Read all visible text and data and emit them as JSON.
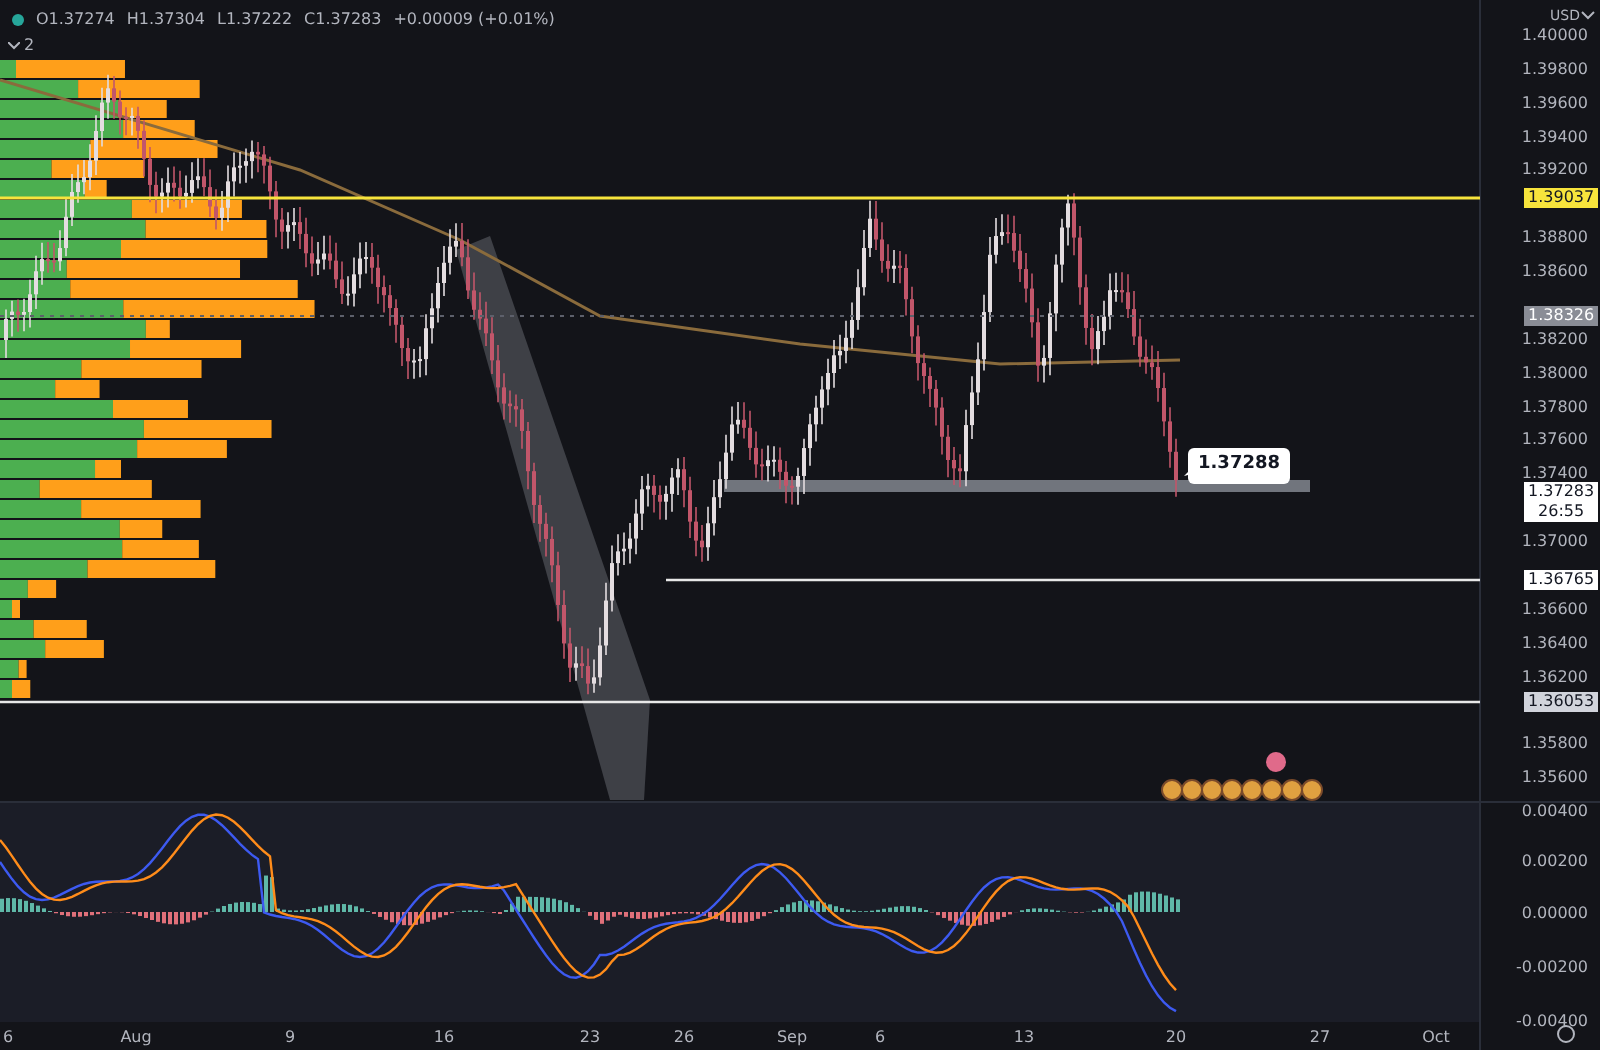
{
  "legend": {
    "values": [
      "O1.37274",
      "H1.37304",
      "L1.37222",
      "C1.37283",
      "+0.00009 (+0.01%)"
    ],
    "collapsed_count": "2"
  },
  "price_axis": {
    "currency": "USD",
    "ticks": [
      "1.40000",
      "1.39800",
      "1.39600",
      "1.39400",
      "1.39200",
      "1.38800",
      "1.38600",
      "1.38200",
      "1.38000",
      "1.37800",
      "1.37600",
      "1.37400",
      "1.37000",
      "1.36600",
      "1.36400",
      "1.36200",
      "1.35800",
      "1.35600"
    ]
  },
  "price_tags": [
    {
      "text": "1.39037",
      "color": "#f7e43c"
    },
    {
      "text": "1.38326",
      "color": "#8a8d96"
    },
    {
      "text": "1.37283",
      "color": "#ffffff",
      "countdown": "26:55"
    },
    {
      "text": "1.36765",
      "color": "#ffffff"
    },
    {
      "text": "1.36053",
      "color": "#d1d4dc"
    }
  ],
  "callout": "1.37288",
  "macd_axis": {
    "ticks": [
      "0.00400",
      "0.00200",
      "0.00000",
      "-0.00200",
      "-0.00400"
    ]
  },
  "time_axis": {
    "labels": [
      "6",
      "Aug",
      "9",
      "16",
      "23",
      "26",
      "Sep",
      "6",
      "13",
      "20",
      "27",
      "Oct"
    ]
  }
}
